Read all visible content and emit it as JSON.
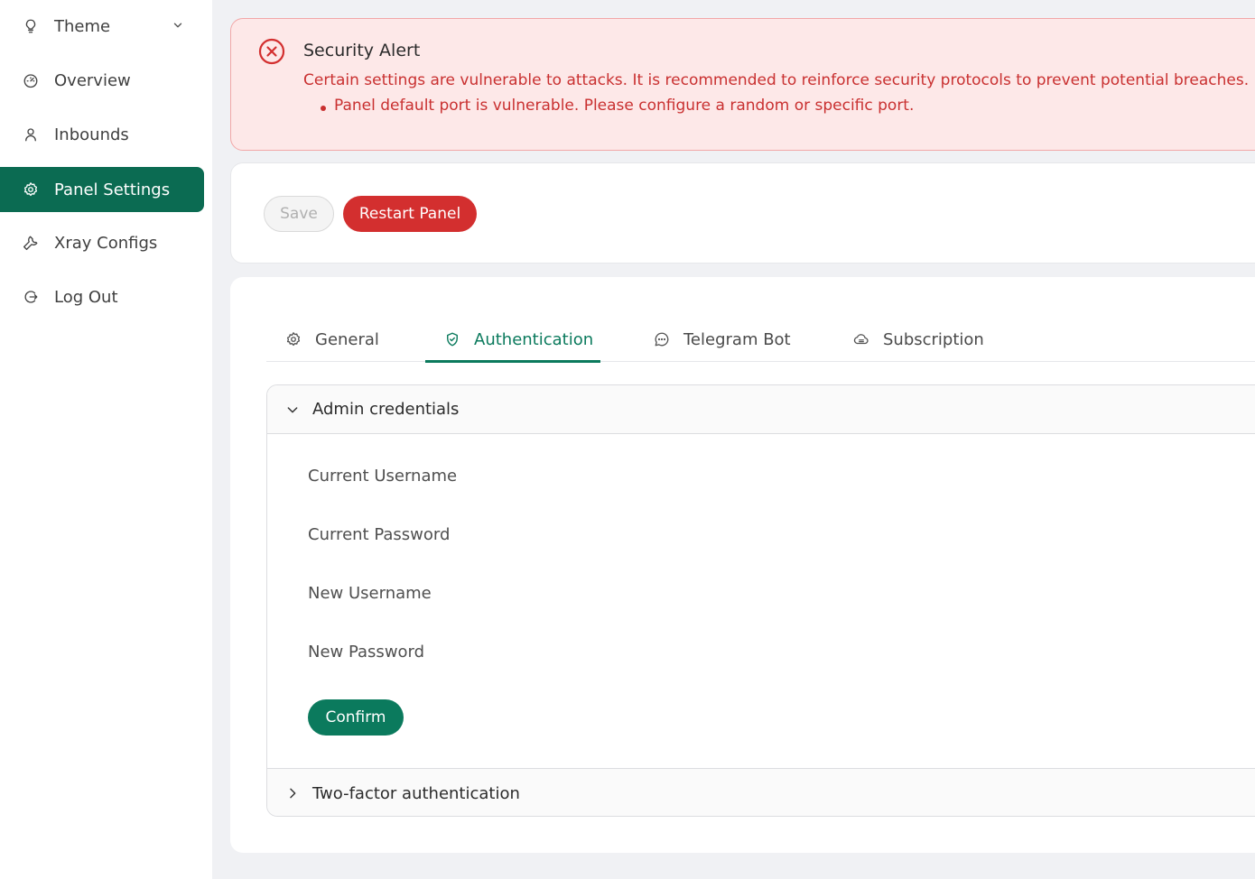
{
  "colors": {
    "accent": "#0b6b52",
    "danger": "#d32f2f",
    "alert_bg": "#fde8e8",
    "alert_text": "#c93030"
  },
  "sidebar": {
    "items": [
      {
        "label": "Theme",
        "icon": "lightbulb-icon",
        "expandable": true
      },
      {
        "label": "Overview",
        "icon": "dashboard-icon"
      },
      {
        "label": "Inbounds",
        "icon": "user-icon"
      },
      {
        "label": "Panel Settings",
        "icon": "gear-icon",
        "active": true
      },
      {
        "label": "Xray Configs",
        "icon": "wrench-icon"
      },
      {
        "label": "Log Out",
        "icon": "logout-icon"
      }
    ]
  },
  "alert": {
    "title": "Security Alert",
    "description": "Certain settings are vulnerable to attacks. It is recommended to reinforce security protocols to prevent potential breaches.",
    "items": [
      "Panel default port is vulnerable. Please configure a random or specific port."
    ]
  },
  "toolbar": {
    "save_label": "Save",
    "restart_label": "Restart Panel"
  },
  "tabs": [
    {
      "label": "General",
      "icon": "gear-icon"
    },
    {
      "label": "Authentication",
      "icon": "shield-icon",
      "active": true
    },
    {
      "label": "Telegram Bot",
      "icon": "chat-icon"
    },
    {
      "label": "Subscription",
      "icon": "cloud-icon"
    }
  ],
  "admin_credentials": {
    "title": "Admin credentials",
    "fields": [
      "Current Username",
      "Current Password",
      "New Username",
      "New Password"
    ],
    "confirm_label": "Confirm"
  },
  "two_factor": {
    "title": "Two-factor authentication"
  }
}
